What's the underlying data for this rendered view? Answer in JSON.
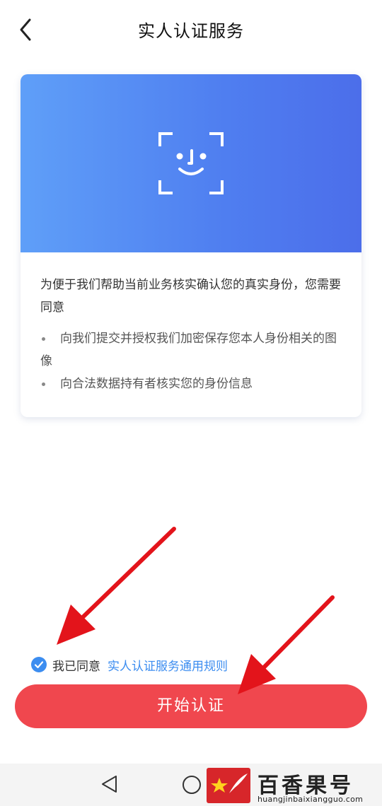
{
  "header": {
    "title": "实人认证服务"
  },
  "card": {
    "intro": "为便于我们帮助当前业务核实确认您的真实身份，您需要同意",
    "bullets": [
      "向我们提交并授权我们加密保存您本人身份相关的图像",
      "向合法数据持有者核实您的身份信息"
    ]
  },
  "agreement": {
    "checked": true,
    "prefix": "我已同意",
    "link": "实人认证服务通用规则"
  },
  "actions": {
    "start_label": "开始认证"
  },
  "watermark": {
    "title": "百香果号",
    "url": "huangjinbaixiangguo.com"
  },
  "colors": {
    "banner_start": "#5f9ff8",
    "banner_end": "#4c6eea",
    "accent": "#3c8df0",
    "button": "#f0474e",
    "annotation_arrow": "#e3141b"
  }
}
